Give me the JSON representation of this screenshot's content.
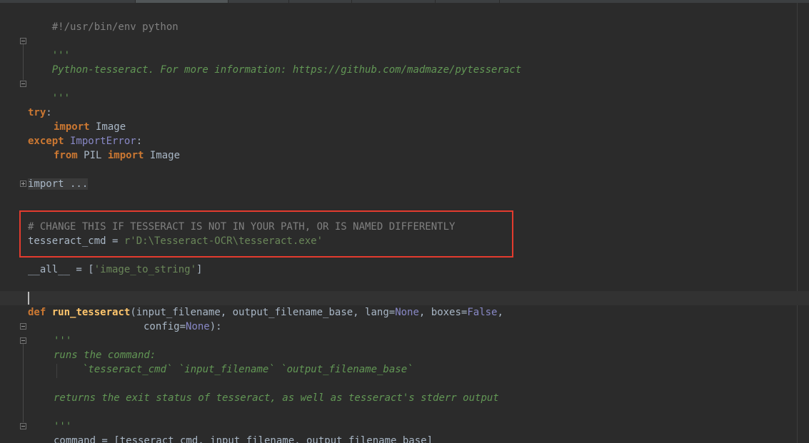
{
  "editor": {
    "lines": {
      "shebang": "#!/usr/bin/env python",
      "doc_open": "'''",
      "doc_text": "Python-tesseract. For more information: https://github.com/madmaze/pytesseract",
      "doc_close": "'''",
      "try_kw": "try",
      "try_colon": ":",
      "import_kw": "import",
      "import_image": " Image",
      "except_kw": "except",
      "import_error": " ImportError",
      "except_colon": ":",
      "from_kw": "from",
      "pil": " PIL ",
      "import_kw2": "import",
      "pil_image": " Image",
      "folded_import": "import ...",
      "comment": "# CHANGE THIS IF TESSERACT IS NOT IN YOUR PATH, OR IS NAMED DIFFERENTLY",
      "cmd_name": "tesseract_cmd = ",
      "cmd_value": "r'D:\\Tesseract-OCR\\tesseract.exe'",
      "all_name": "__all__ = [",
      "all_value": "'image_to_string'",
      "all_close": "]",
      "def_kw": "def",
      "func_name": " run_tesseract",
      "params_1": "(input_filename, output_filename_base, lang=",
      "none_1": "None",
      "params_2": ", boxes=",
      "false_1": "False",
      "params_3": ",",
      "config_1": "config=",
      "none_2": "None",
      "config_2": "):",
      "fdoc_open": "'''",
      "fdoc_runs": "runs the command:",
      "fdoc_args": "`tesseract_cmd` `input_filename` `output_filename_base`",
      "fdoc_returns": "returns the exit status of tesseract, as well as tesseract's stderr output",
      "fdoc_close": "'''",
      "command_line": "command = [tesseract_cmd, input_filename, output_filename_base]"
    },
    "colors": {
      "background": "#2b2b2b",
      "keyword": "#cc7832",
      "docstring": "#629755",
      "string": "#6a8759",
      "comment": "#808080",
      "builtin": "#8888c6",
      "text": "#a9b7c6",
      "highlight_box": "#e33b2e"
    }
  }
}
